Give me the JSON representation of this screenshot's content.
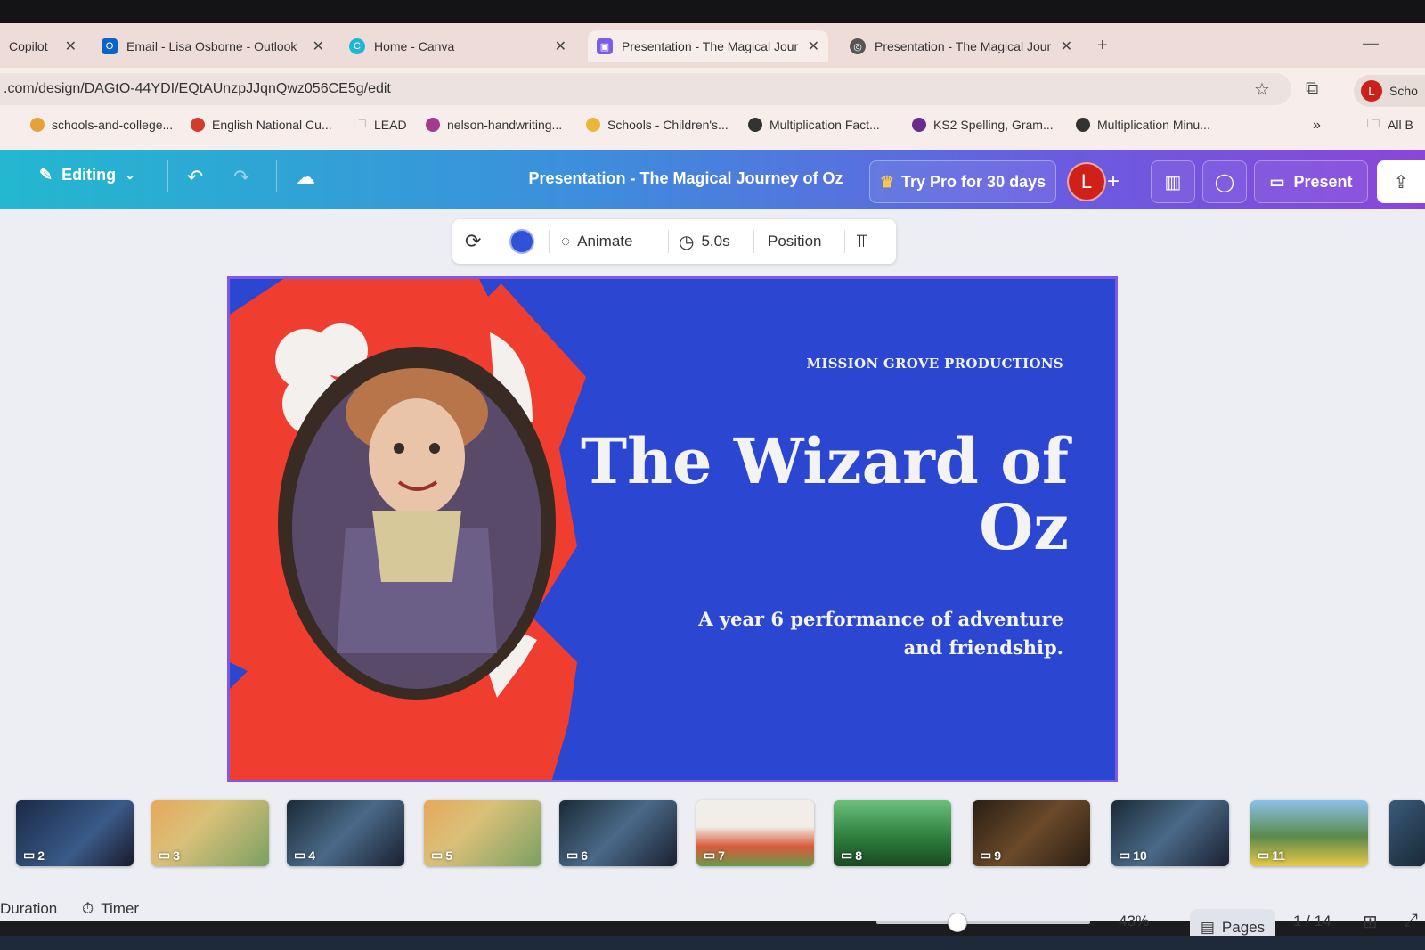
{
  "browser": {
    "tabs": [
      {
        "label": "Copilot"
      },
      {
        "label": "Email - Lisa Osborne - Outlook"
      },
      {
        "label": "Home - Canva"
      },
      {
        "label": "Presentation - The Magical Jour"
      },
      {
        "label": "Presentation - The Magical Jour"
      }
    ],
    "url": ".com/design/DAGtO-44YDI/EQtAUnzpJJqnQwz056CE5g/edit",
    "profile_initial": "L",
    "profile_label": "Scho",
    "bookmarks": [
      {
        "label": "schools-and-college..."
      },
      {
        "label": "English National Cu..."
      },
      {
        "label": "LEAD"
      },
      {
        "label": "nelson-handwriting..."
      },
      {
        "label": "Schools - Children's..."
      },
      {
        "label": "Multiplication Fact..."
      },
      {
        "label": "KS2 Spelling, Gram..."
      },
      {
        "label": "Multiplication Minu..."
      }
    ],
    "bookmarks_more": "»",
    "all_bookmarks": "All B"
  },
  "canva": {
    "mode_label": "Editing",
    "doc_title": "Presentation - The Magical Journey of Oz",
    "try_pro": "Try Pro for 30 days",
    "user_initial": "L",
    "present_label": "Present",
    "toolbar": {
      "animate": "Animate",
      "duration": "5.0s",
      "position": "Position"
    },
    "slide": {
      "producer": "MISSION GROVE PRODUCTIONS",
      "title": "The Wizard of Oz",
      "subtitle": "A year 6 performance of adventure and friendship."
    },
    "thumbnails": [
      {
        "page": "2"
      },
      {
        "page": "3"
      },
      {
        "page": "4"
      },
      {
        "page": "5"
      },
      {
        "page": "6"
      },
      {
        "page": "7"
      },
      {
        "page": "8"
      },
      {
        "page": "9"
      },
      {
        "page": "10"
      },
      {
        "page": "11"
      }
    ],
    "footer": {
      "duration": "Duration",
      "timer": "Timer",
      "zoom": "43%",
      "pages": "Pages",
      "page_count": "1 / 14"
    }
  },
  "colors": {
    "slide_blue": "#2b46d0",
    "slide_red": "#ef3d2f",
    "canva_purple": "#8b46d9",
    "canva_teal": "#23b8cf"
  }
}
